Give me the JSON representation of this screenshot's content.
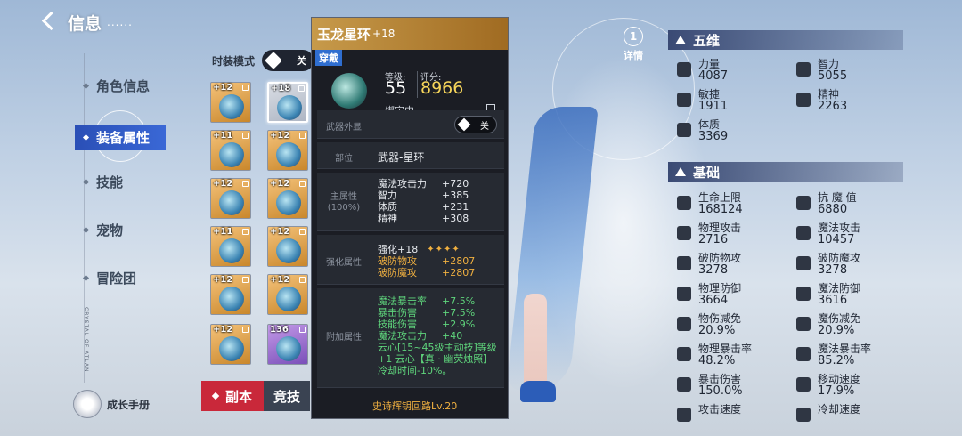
{
  "header": {
    "title": "信息",
    "dots": "......"
  },
  "nav": [
    {
      "label": "角色信息",
      "active": false
    },
    {
      "label": "装备属性",
      "active": true
    },
    {
      "label": "技能",
      "active": false
    },
    {
      "label": "宠物",
      "active": false
    },
    {
      "label": "冒险团",
      "active": false
    }
  ],
  "growth_book": "成长手册",
  "vertical_caption": "CRYSTAL OF ATLAN",
  "fashion_mode": {
    "label": "时装模式",
    "state": "关"
  },
  "equipment": [
    {
      "level": "+12",
      "rarity": "orange",
      "icon": "shoulder-icon"
    },
    {
      "level": "+18",
      "rarity": "gray",
      "icon": "ring-icon",
      "selected": true
    },
    {
      "level": "+11",
      "rarity": "orange",
      "icon": "chest-armor-icon"
    },
    {
      "level": "+12",
      "rarity": "orange",
      "icon": "cape-icon"
    },
    {
      "level": "+12",
      "rarity": "orange",
      "icon": "gauntlet-icon"
    },
    {
      "level": "+12",
      "rarity": "orange",
      "icon": "bracer-icon"
    },
    {
      "level": "+11",
      "rarity": "orange",
      "icon": "leg-armor-icon"
    },
    {
      "level": "+12",
      "rarity": "orange",
      "icon": "belt-icon"
    },
    {
      "level": "+12",
      "rarity": "orange",
      "icon": "boots-icon"
    },
    {
      "level": "+12",
      "rarity": "orange",
      "icon": "necklace-icon"
    },
    {
      "level": "+12",
      "rarity": "orange",
      "icon": "medallion-icon"
    },
    {
      "level": "136",
      "rarity": "purple",
      "icon": "box-icon"
    }
  ],
  "bottom_tabs": {
    "dungeon": "副本",
    "arena": "竞技"
  },
  "item": {
    "name": "玉龙星环",
    "plus": "+18",
    "equipped": "穿戴",
    "level_label": "等级:",
    "level": "55",
    "score_label": "评分:",
    "score": "8966",
    "bound": "绑定中",
    "weapon_appearance": {
      "label": "武器外显",
      "state": "关"
    },
    "slot": {
      "label": "部位",
      "value": "武器-星环"
    },
    "main_attr": {
      "label": "主属性",
      "sub": "(100%)",
      "stats": [
        {
          "name": "魔法攻击力",
          "value": "+720"
        },
        {
          "name": "智力",
          "value": "+385"
        },
        {
          "name": "体质",
          "value": "+231"
        },
        {
          "name": "精神",
          "value": "+308"
        }
      ]
    },
    "enhance": {
      "label": "强化属性",
      "level": "强化+18",
      "stars": "✦✦✦✦",
      "stats": [
        {
          "name": "破防物攻",
          "value": "+2807"
        },
        {
          "name": "破防魔攻",
          "value": "+2807"
        }
      ]
    },
    "extra": {
      "label": "附加属性",
      "stats": [
        {
          "name": "魔法暴击率",
          "value": "+7.5%"
        },
        {
          "name": "暴击伤害",
          "value": "+7.5%"
        },
        {
          "name": "技能伤害",
          "value": "+2.9%"
        },
        {
          "name": "魔法攻击力",
          "value": "+40"
        }
      ],
      "desc": "云心[15~45级主动技]等级+1 云心【真 · 幽荧烛照】冷却时间-10%。"
    },
    "epic": "史诗辉钥回路Lv.20"
  },
  "detail": {
    "icon": "1",
    "label": "详情"
  },
  "five_dims": {
    "title": "五维",
    "stats": [
      {
        "label": "力量",
        "value": "4087",
        "icon": "fist-icon"
      },
      {
        "label": "智力",
        "value": "5055",
        "icon": "brain-icon"
      },
      {
        "label": "敏捷",
        "value": "1911",
        "icon": "wing-icon"
      },
      {
        "label": "精神",
        "value": "2263",
        "icon": "spirit-icon"
      },
      {
        "label": "体质",
        "value": "3369",
        "icon": "arm-icon"
      }
    ]
  },
  "basics": {
    "title": "基础",
    "stats": [
      {
        "label": "生命上限",
        "value": "168124",
        "icon": "heart-icon"
      },
      {
        "label": "抗 魔 值",
        "value": "6880",
        "icon": "demon-icon"
      },
      {
        "label": "物理攻击",
        "value": "2716",
        "icon": "sword-icon"
      },
      {
        "label": "魔法攻击",
        "value": "10457",
        "icon": "staff-icon"
      },
      {
        "label": "破防物攻",
        "value": "3278",
        "icon": "broken-shield-icon"
      },
      {
        "label": "破防魔攻",
        "value": "3278",
        "icon": "broken-magic-shield-icon"
      },
      {
        "label": "物理防御",
        "value": "3664",
        "icon": "shield-icon"
      },
      {
        "label": "魔法防御",
        "value": "3616",
        "icon": "magic-shield-icon"
      },
      {
        "label": "物伤减免",
        "value": "20.9%",
        "icon": "physical-reduce-icon"
      },
      {
        "label": "魔伤减免",
        "value": "20.9%",
        "icon": "magic-reduce-icon"
      },
      {
        "label": "物理暴击率",
        "value": "48.2%",
        "icon": "physical-crit-icon"
      },
      {
        "label": "魔法暴击率",
        "value": "85.2%",
        "icon": "magic-crit-icon"
      },
      {
        "label": "暴击伤害",
        "value": "150.0%",
        "icon": "crit-damage-icon"
      },
      {
        "label": "移动速度",
        "value": "17.9%",
        "icon": "boot-speed-icon"
      },
      {
        "label": "攻击速度",
        "value": "",
        "icon": "attack-speed-icon"
      },
      {
        "label": "冷却速度",
        "value": "",
        "icon": "cooldown-icon"
      }
    ]
  }
}
